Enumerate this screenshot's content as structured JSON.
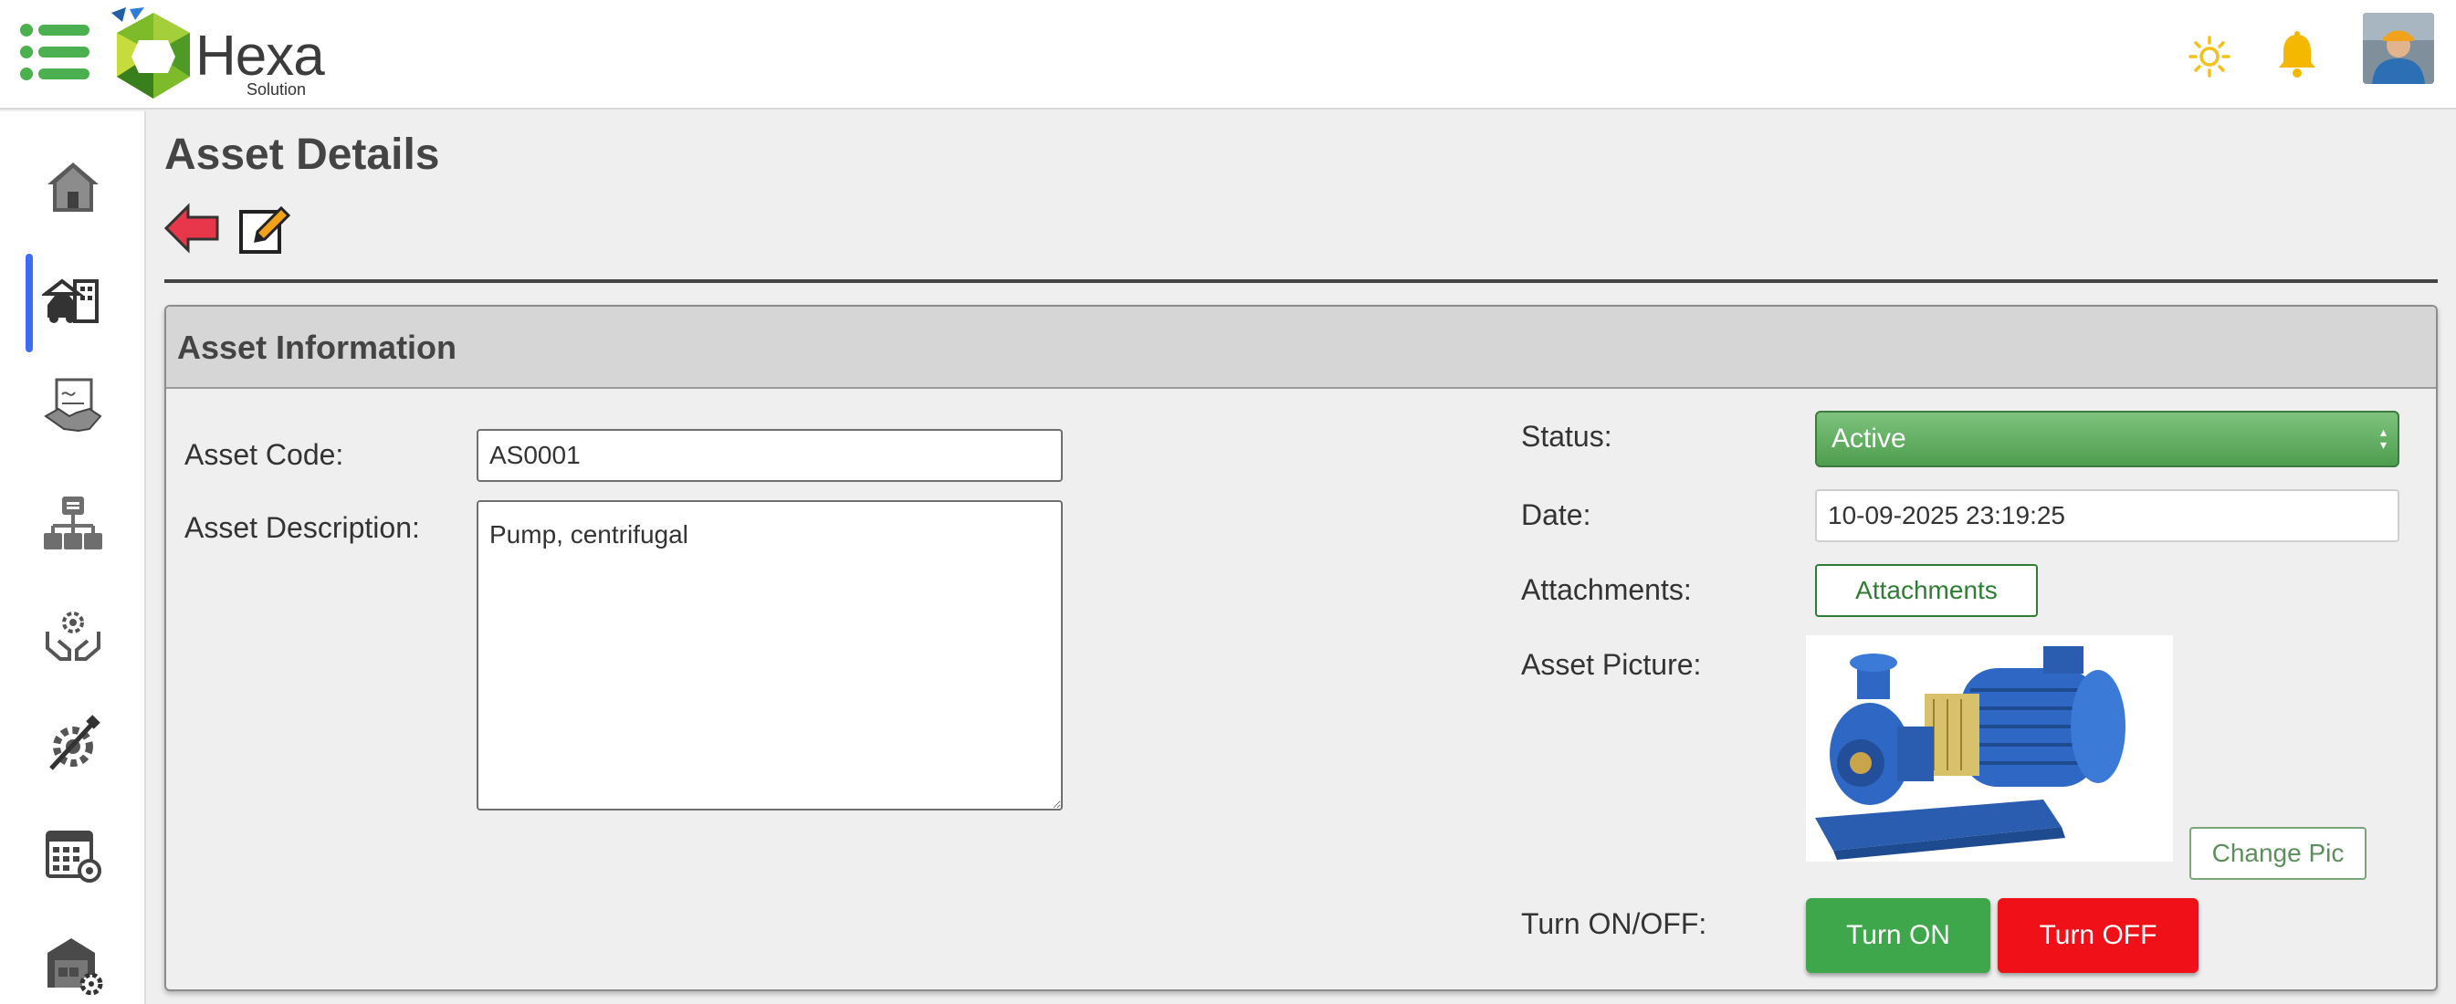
{
  "brand": {
    "name": "Hexa",
    "tagline": "Solution"
  },
  "header": {
    "icons": [
      "menu-icon",
      "sun-icon",
      "bell-icon",
      "user-avatar"
    ]
  },
  "sidebar": {
    "items": [
      "home-icon",
      "assets-icon",
      "contracts-icon",
      "hierarchy-icon",
      "maintenance-icon",
      "tools-icon",
      "schedule-icon",
      "warehouse-icon"
    ],
    "active_index": 1
  },
  "page": {
    "title": "Asset Details"
  },
  "card": {
    "title": "Asset Information",
    "asset_code_label": "Asset Code:",
    "asset_code_value": "AS0001",
    "asset_description_label": "Asset Description:",
    "asset_description_value": "Pump, centrifugal",
    "status_label": "Status:",
    "status_value": "Active",
    "date_label": "Date:",
    "date_value": "10-09-2025 23:19:25",
    "attachments_label": "Attachments:",
    "attachments_button": "Attachments",
    "picture_label": "Asset Picture:",
    "change_pic_button": "Change Pic",
    "turn_label": "Turn ON/OFF:",
    "turn_on_button": "Turn ON",
    "turn_off_button": "Turn OFF"
  },
  "colors": {
    "accent_green": "#3ea64b",
    "danger_red": "#f01018",
    "active_nav": "#3d6df2"
  }
}
